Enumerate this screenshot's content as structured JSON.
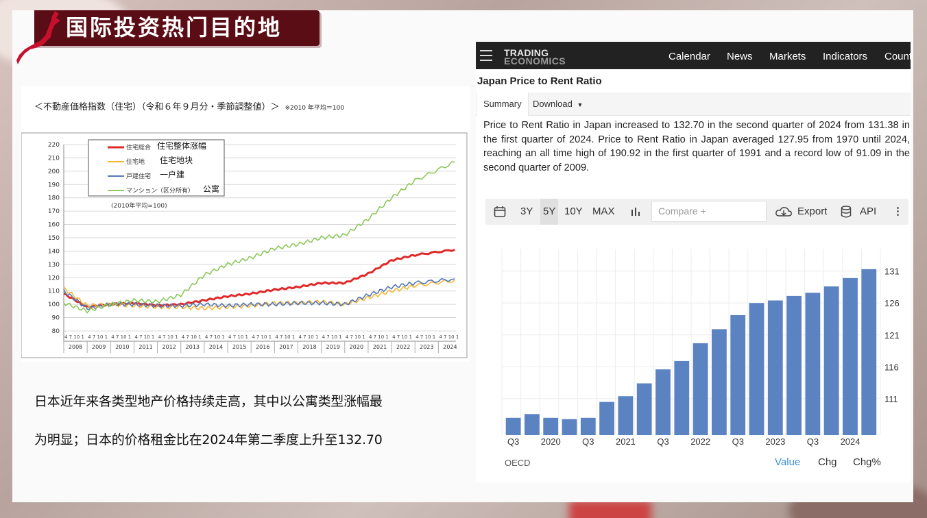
{
  "title": "国际投资热门目的地",
  "left_chart": {
    "heading": "＜不動産価格指数（住宅）（令和６年９月分・季節調整値）＞",
    "note": "※2010 年平均＝100",
    "legend": [
      {
        "jp": "住宅総合",
        "cn": "住宅整体涨幅",
        "color": "#e02a2a"
      },
      {
        "jp": "住宅地",
        "cn": "住宅地块",
        "color": "#f2b632"
      },
      {
        "jp": "戸建住宅",
        "cn": "一户建",
        "color": "#5577b8"
      },
      {
        "jp": "マンション（区分所有）",
        "cn": "公寓",
        "color": "#8cc85a"
      }
    ],
    "base_note": "(2010年平均=100)",
    "y_ticks": [
      "220",
      "210",
      "200",
      "190",
      "180",
      "170",
      "160",
      "150",
      "140",
      "130",
      "120",
      "110",
      "100",
      "90",
      "80"
    ],
    "years": [
      "2008",
      "2009",
      "2010",
      "2011",
      "2012",
      "2013",
      "2014",
      "2015",
      "2016",
      "2017",
      "2018",
      "2019",
      "2020",
      "2021",
      "2022",
      "2023",
      "2024"
    ],
    "month_labels": "4 7 10 1"
  },
  "chart_data": [
    {
      "type": "line",
      "title": "不動産価格指数（住宅）（令和６年９月分・季節調整値）",
      "x": [
        2008,
        2009,
        2010,
        2011,
        2012,
        2013,
        2014,
        2015,
        2016,
        2017,
        2018,
        2019,
        2020,
        2021,
        2022,
        2023,
        2024.7
      ],
      "series": [
        {
          "name": "住宅総合",
          "values": [
            108,
            98,
            100,
            101,
            99,
            100,
            103,
            106,
            108,
            111,
            113,
            116,
            116,
            123,
            133,
            137,
            141
          ]
        },
        {
          "name": "住宅地",
          "values": [
            112,
            99,
            100,
            99,
            98,
            98,
            97,
            98,
            99,
            101,
            101,
            102,
            100,
            105,
            110,
            114,
            118
          ]
        },
        {
          "name": "戸建住宅",
          "values": [
            110,
            97,
            100,
            100,
            99,
            99,
            100,
            99,
            100,
            100,
            101,
            101,
            100,
            107,
            113,
            116,
            119
          ]
        },
        {
          "name": "マンション（区分所有）",
          "values": [
            101,
            95,
            100,
            103,
            102,
            107,
            122,
            130,
            135,
            142,
            145,
            150,
            152,
            164,
            180,
            193,
            207
          ]
        }
      ],
      "ylim": [
        80,
        220
      ]
    },
    {
      "type": "bar",
      "title": "Japan Price to Rent Ratio",
      "categories": [
        "2019Q3",
        "2019Q4",
        "2020Q1",
        "2020Q2",
        "2020Q3",
        "2020Q4",
        "2021Q1",
        "2021Q2",
        "2021Q3",
        "2021Q4",
        "2022Q1",
        "2022Q2",
        "2022Q3",
        "2022Q4",
        "2023Q1",
        "2023Q2",
        "2023Q3",
        "2023Q4",
        "2024Q1",
        "2024Q2"
      ],
      "values": [
        108.0,
        108.6,
        108.0,
        107.8,
        108.0,
        110.5,
        111.4,
        113.4,
        115.6,
        116.9,
        119.7,
        121.9,
        124.1,
        126.0,
        126.4,
        127.1,
        127.6,
        128.6,
        129.9,
        131.3
      ],
      "x_ticks": [
        "Q3",
        "2020",
        "Q3",
        "2021",
        "Q3",
        "2022",
        "Q3",
        "2023",
        "Q3",
        "2024"
      ],
      "y_ticks": [
        "131",
        "126",
        "121",
        "116",
        "111"
      ],
      "ylim": [
        105.3,
        134.5
      ]
    }
  ],
  "description": {
    "line1": "日本近年来各类型地产价格持续走高，其中以公寓类型涨幅最",
    "line2": "为明显；日本的价格租金比在2024年第二季度上升至132.70"
  },
  "te": {
    "logo_top": "TRADING",
    "logo_bottom": "ECONOMICS",
    "nav": [
      "Calendar",
      "News",
      "Markets",
      "Indicators",
      "Count"
    ],
    "heading": "Japan Price to Rent Ratio",
    "tabs": {
      "summary": "Summary",
      "download": "Download"
    },
    "summary": "Price to Rent Ratio in Japan increased to 132.70 in the second quarter of 2024 from 131.38 in the first quarter of 2024. Price to Rent Ratio in Japan averaged 127.95 from 1970 until 2024, reaching an all time high of 190.92 in the first quarter of 1991 and a record low of 91.09 in the second quarter of 2009.",
    "toolbar": {
      "r3y": "3Y",
      "r5y": "5Y",
      "r10y": "10Y",
      "rmax": "MAX",
      "compare": "Compare +",
      "export": "Export",
      "api": "API"
    },
    "footer": {
      "source": "OECD",
      "value": "Value",
      "chg": "Chg",
      "chgp": "Chg%"
    }
  },
  "colors": {
    "banner": "#5a0d15",
    "bar": "#5b83c2",
    "link": "#3b8fe0"
  }
}
